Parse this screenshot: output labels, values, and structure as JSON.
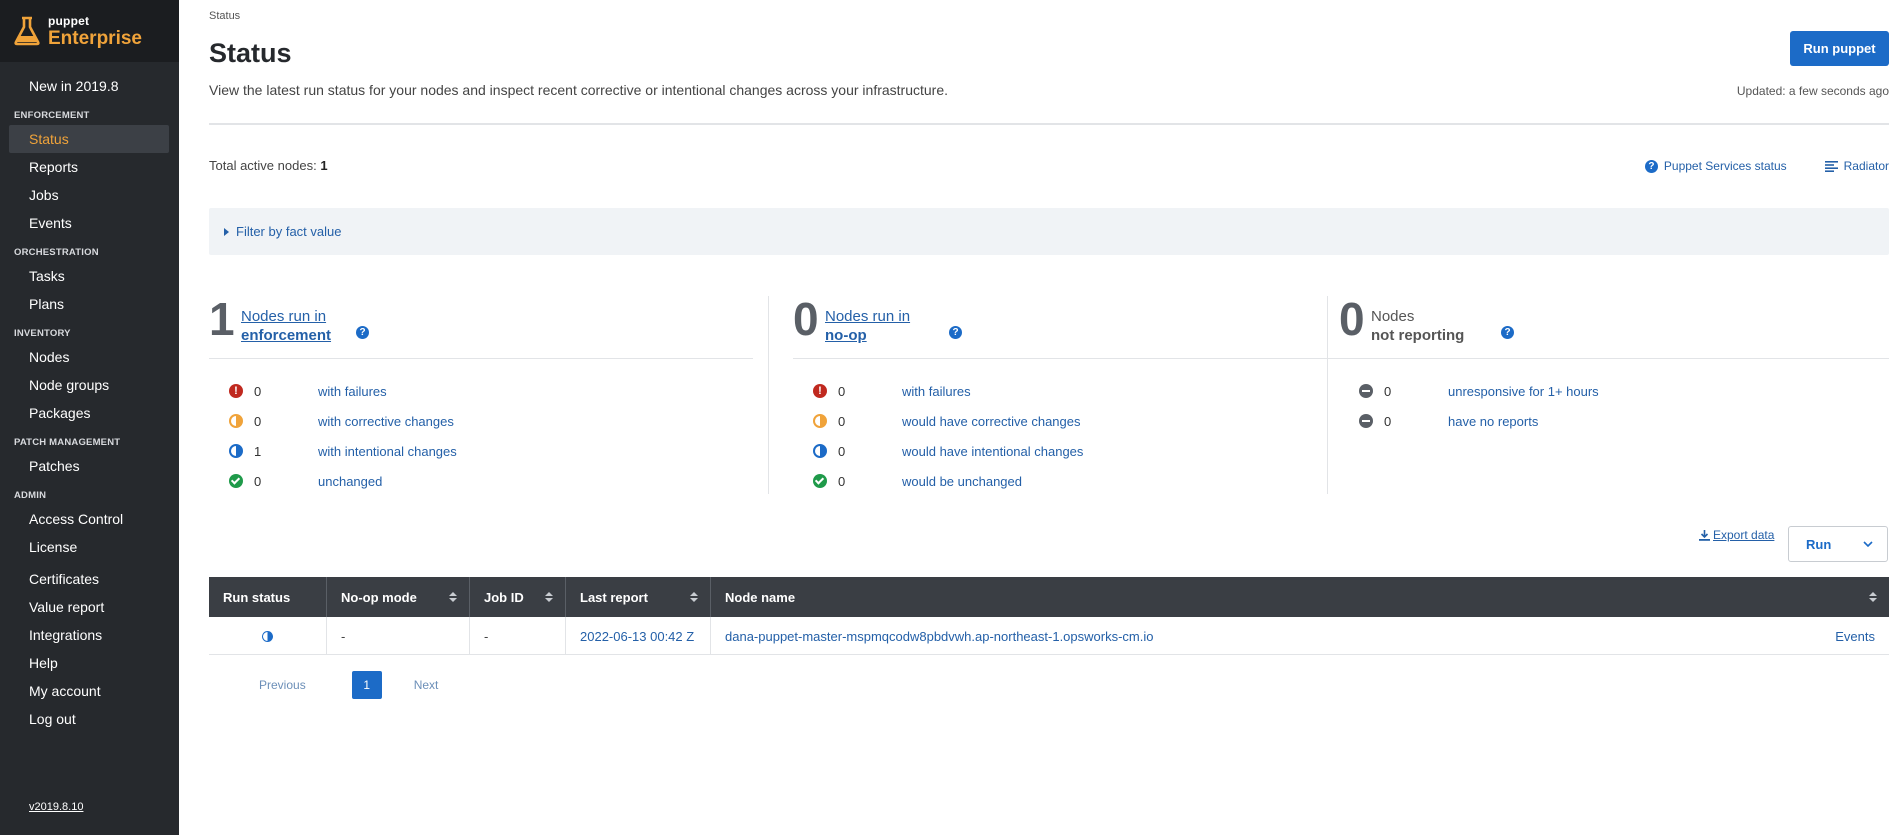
{
  "brand": {
    "small": "puppet",
    "big": "Enterprise"
  },
  "nav": {
    "top": [
      {
        "label": "New in 2019.8"
      }
    ],
    "sections": [
      {
        "title": "ENFORCEMENT",
        "items": [
          "Status",
          "Reports",
          "Jobs",
          "Events"
        ]
      },
      {
        "title": "ORCHESTRATION",
        "items": [
          "Tasks",
          "Plans"
        ]
      },
      {
        "title": "INVENTORY",
        "items": [
          "Nodes",
          "Node groups",
          "Packages"
        ]
      },
      {
        "title": "PATCH MANAGEMENT",
        "items": [
          "Patches"
        ]
      },
      {
        "title": "ADMIN",
        "items": [
          "Access Control",
          "License",
          "Certificates",
          "Value report",
          "Integrations",
          "Help",
          "My account",
          "Log out"
        ]
      }
    ],
    "active": "Status",
    "version": "v2019.8.10"
  },
  "page": {
    "breadcrumb": "Status",
    "title": "Status",
    "subtitle": "View the latest run status for your nodes and inspect recent corrective or intentional changes across your infrastructure.",
    "run_button": "Run puppet",
    "updated": "Updated: a few seconds ago",
    "total_label": "Total active nodes:",
    "total_value": "1",
    "services_link": "Puppet Services status",
    "radiator_link": "Radiator",
    "filter_label": "Filter by fact value"
  },
  "cards": [
    {
      "count": "1",
      "line1": "Nodes run in",
      "line2": "enforcement",
      "rows": [
        {
          "icon": "fail",
          "count": "0",
          "label": "with failures"
        },
        {
          "icon": "corr",
          "count": "0",
          "label": "with corrective changes"
        },
        {
          "icon": "int",
          "count": "1",
          "label": "with intentional changes"
        },
        {
          "icon": "ok",
          "count": "0",
          "label": "unchanged"
        }
      ]
    },
    {
      "count": "0",
      "line1": "Nodes run in",
      "line2": "no-op",
      "rows": [
        {
          "icon": "fail",
          "count": "0",
          "label": "with failures"
        },
        {
          "icon": "corr",
          "count": "0",
          "label": "would have corrective changes"
        },
        {
          "icon": "int",
          "count": "0",
          "label": "would have intentional changes"
        },
        {
          "icon": "ok",
          "count": "0",
          "label": "would be unchanged"
        }
      ]
    },
    {
      "count": "0",
      "line1": "Nodes",
      "line2": "not reporting",
      "rows": [
        {
          "icon": "none",
          "count": "0",
          "label": "unresponsive for 1+ hours"
        },
        {
          "icon": "none",
          "count": "0",
          "label": "have no reports"
        }
      ]
    }
  ],
  "table": {
    "export_label": "Export data",
    "run_dropdown": "Run",
    "columns": [
      "Run status",
      "No-op mode",
      "Job ID",
      "Last report",
      "Node name"
    ],
    "rows": [
      {
        "noop": "-",
        "job_id": "-",
        "last_report": "2022-06-13 00:42 Z",
        "node_name": "dana-puppet-master-mspmqcodw8pbdvwh.ap-northeast-1.opsworks-cm.io",
        "action": "Events"
      }
    ]
  },
  "pager": {
    "previous": "Previous",
    "current": "1",
    "next": "Next"
  }
}
